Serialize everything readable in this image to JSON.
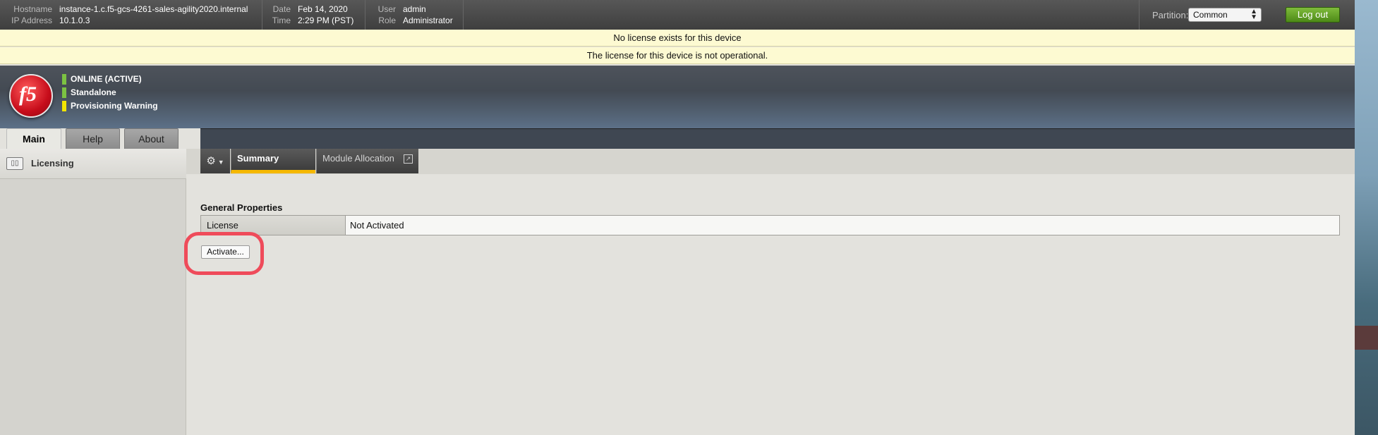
{
  "header": {
    "hostname_label": "Hostname",
    "hostname": "instance-1.c.f5-gcs-4261-sales-agility2020.internal",
    "ip_label": "IP Address",
    "ip": "10.1.0.3",
    "date_label": "Date",
    "date": "Feb 14, 2020",
    "time_label": "Time",
    "time": "2:29 PM (PST)",
    "user_label": "User",
    "user": "admin",
    "role_label": "Role",
    "role": "Administrator",
    "partition_label": "Partition:",
    "partition_value": "Common",
    "logout_label": "Log out"
  },
  "warnings": [
    "No license exists for this device",
    "The license for this device is not operational."
  ],
  "banner": {
    "logo_text": "f5",
    "statuses": [
      {
        "label": "ONLINE (ACTIVE)",
        "color": "#7cc242"
      },
      {
        "label": "Standalone",
        "color": "#7cc242"
      },
      {
        "label": "Provisioning Warning",
        "color": "#f2e500"
      }
    ]
  },
  "tabs": [
    "Main",
    "Help",
    "About"
  ],
  "sidebar": {
    "items": [
      {
        "label": "Licensing",
        "icon": "license-icon"
      }
    ]
  },
  "subnav": {
    "gear_icon": "⚙",
    "tabs": [
      "Summary",
      "Module Allocation"
    ]
  },
  "main": {
    "section_title": "General Properties",
    "rows": [
      {
        "key": "License",
        "value": "Not Activated"
      }
    ],
    "activate_label": "Activate..."
  },
  "colors": {
    "accent_yellow": "#f5b800",
    "highlight_red": "#ef4b5a",
    "logout_green": "#5f9c24"
  }
}
